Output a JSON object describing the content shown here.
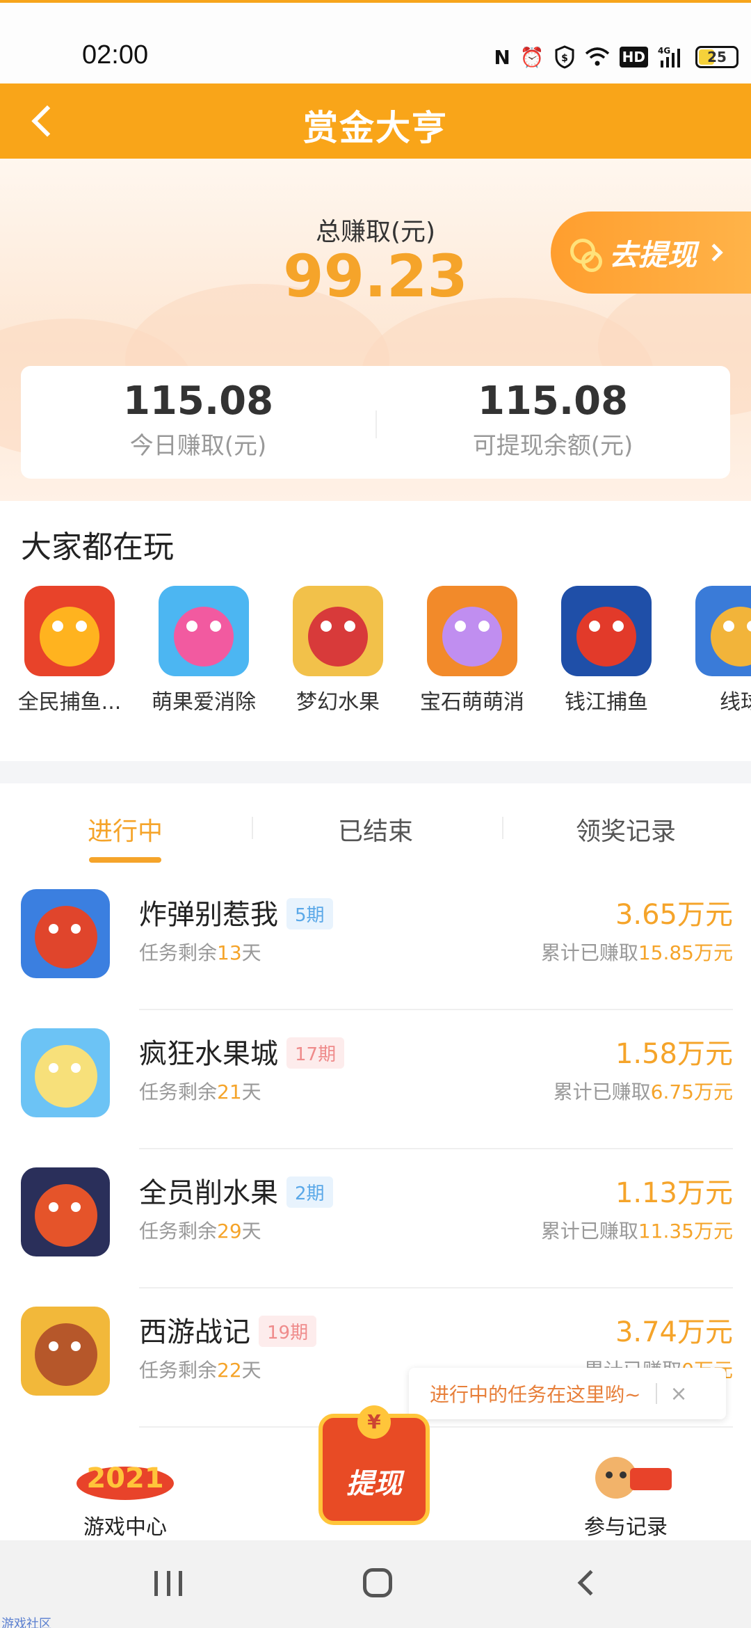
{
  "status_bar": {
    "time": "02:00",
    "icons": [
      "nfc-icon",
      "alarm-icon",
      "shield-icon",
      "wifi-icon",
      "hd-icon",
      "signal-4g-icon"
    ],
    "hd_label": "HD",
    "network_label": "4G",
    "battery": "25"
  },
  "header": {
    "title": "赏金大亨"
  },
  "summary": {
    "total_label": "总赚取(元)",
    "total_value": "99.23",
    "withdraw_label": "去提现",
    "today_value": "115.08",
    "today_label": "今日赚取(元)",
    "balance_value": "115.08",
    "balance_label": "可提现余额(元)"
  },
  "playing": {
    "title": "大家都在玩",
    "games": [
      {
        "name": "全民捕鱼...",
        "colors": [
          "#e8432a",
          "#ffb31f"
        ]
      },
      {
        "name": "萌果爱消除",
        "colors": [
          "#4cb6f2",
          "#f25aa0"
        ]
      },
      {
        "name": "梦幻水果",
        "colors": [
          "#f2c14a",
          "#d83a3a"
        ]
      },
      {
        "name": "宝石萌萌消",
        "colors": [
          "#f28a2a",
          "#c08ef0"
        ]
      },
      {
        "name": "钱江捕鱼",
        "colors": [
          "#1f4fa8",
          "#e23a2a"
        ]
      },
      {
        "name": "线球",
        "colors": [
          "#3a7bd8",
          "#f2b43a"
        ]
      }
    ]
  },
  "tabs": [
    "进行中",
    "已结束",
    "领奖记录"
  ],
  "tasks": [
    {
      "name": "炸弹别惹我",
      "period": "5期",
      "badge": "blue",
      "days_prefix": "任务剩余",
      "days": "13",
      "days_suffix": "天",
      "amount": "3.65万元",
      "acc_prefix": "累计已赚取",
      "acc": "15.85万元",
      "colors": [
        "#3b7fe0",
        "#e0452c"
      ]
    },
    {
      "name": "疯狂水果城",
      "period": "17期",
      "badge": "red",
      "days_prefix": "任务剩余",
      "days": "21",
      "days_suffix": "天",
      "amount": "1.58万元",
      "acc_prefix": "累计已赚取",
      "acc": "6.75万元",
      "colors": [
        "#6cc3f5",
        "#f7e07a"
      ]
    },
    {
      "name": "全员削水果",
      "period": "2期",
      "badge": "blue",
      "days_prefix": "任务剩余",
      "days": "29",
      "days_suffix": "天",
      "amount": "1.13万元",
      "acc_prefix": "累计已赚取",
      "acc": "11.35万元",
      "colors": [
        "#2a2f5a",
        "#e5542a"
      ]
    },
    {
      "name": "西游战记",
      "period": "19期",
      "badge": "red",
      "days_prefix": "任务剩余",
      "days": "22",
      "days_suffix": "天",
      "amount": "3.74万元",
      "acc_prefix": "累计已赚取",
      "acc": "0万元",
      "colors": [
        "#f2b83a",
        "#b6572a"
      ]
    }
  ],
  "tooltip": {
    "text": "进行中的任务在这里哟~",
    "close": "×"
  },
  "bottom_bar": {
    "game_center": "游戏中心",
    "withdraw": "提现",
    "withdraw_coin": "¥",
    "records": "参与记录"
  },
  "watermark": "游戏社区"
}
